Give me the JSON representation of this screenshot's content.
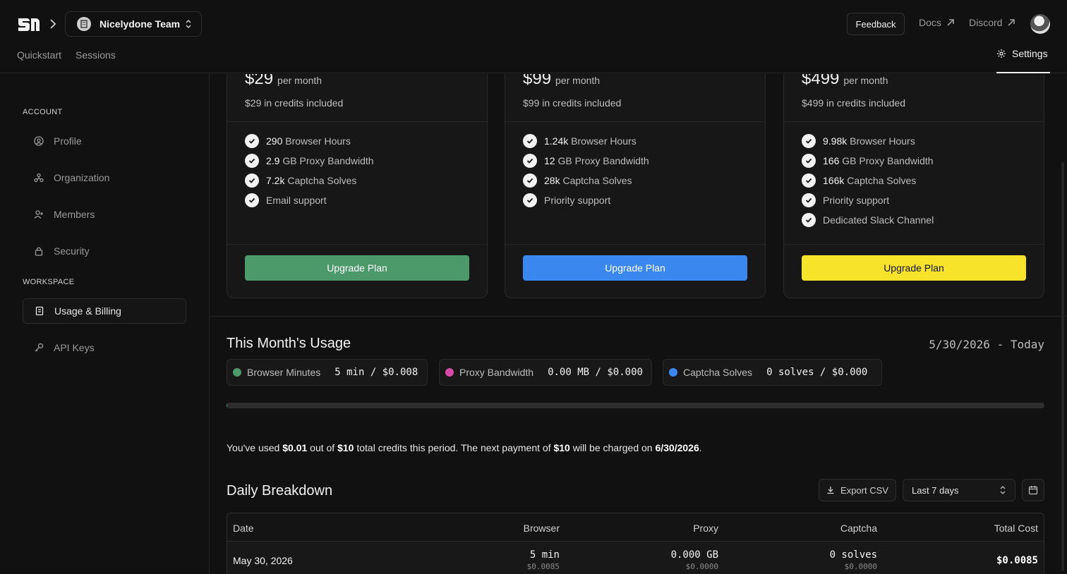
{
  "header": {
    "team_name": "Nicelydone Team",
    "feedback_label": "Feedback",
    "docs_label": "Docs",
    "discord_label": "Discord",
    "tabs": [
      {
        "label": "Quickstart"
      },
      {
        "label": "Sessions"
      }
    ],
    "settings_label": "Settings"
  },
  "sidebar": {
    "account_heading": "ACCOUNT",
    "workspace_heading": "WORKSPACE",
    "items": [
      {
        "label": "Profile",
        "icon": "user-circle-icon"
      },
      {
        "label": "Organization",
        "icon": "organization-icon"
      },
      {
        "label": "Members",
        "icon": "user-plus-icon"
      },
      {
        "label": "Security",
        "icon": "lock-icon"
      },
      {
        "label": "Usage & Billing",
        "icon": "receipt-icon"
      },
      {
        "label": "API Keys",
        "icon": "key-icon"
      }
    ],
    "active": "Usage & Billing"
  },
  "plans": [
    {
      "price": "$29",
      "per": "per month",
      "credits": "$29 in credits included",
      "features": [
        {
          "value": "290",
          "label": "Browser Hours"
        },
        {
          "value": "2.9",
          "label": "GB Proxy Bandwidth"
        },
        {
          "value": "7.2k",
          "label": "Captcha Solves"
        },
        {
          "value": "",
          "label": "Email support"
        }
      ],
      "button": "Upgrade Plan",
      "button_color": "#4c9a6a",
      "button_text_color": "#ffffff"
    },
    {
      "price": "$99",
      "per": "per month",
      "credits": "$99 in credits included",
      "features": [
        {
          "value": "1.24k",
          "label": "Browser Hours"
        },
        {
          "value": "12",
          "label": "GB Proxy Bandwidth"
        },
        {
          "value": "28k",
          "label": "Captcha Solves"
        },
        {
          "value": "",
          "label": "Priority support"
        }
      ],
      "button": "Upgrade Plan",
      "button_color": "#3b87f0",
      "button_text_color": "#ffffff"
    },
    {
      "price": "$499",
      "per": "per month",
      "credits": "$499 in credits included",
      "features": [
        {
          "value": "9.98k",
          "label": "Browser Hours"
        },
        {
          "value": "166",
          "label": "GB Proxy Bandwidth"
        },
        {
          "value": "166k",
          "label": "Captcha Solves"
        },
        {
          "value": "",
          "label": "Priority support"
        },
        {
          "value": "",
          "label": "Dedicated Slack Channel"
        }
      ],
      "button": "Upgrade Plan",
      "button_color": "#f7e32a",
      "button_text_color": "#111111"
    }
  ],
  "usage": {
    "title": "This Month's Usage",
    "range": "5/30/2026 - Today",
    "chips": [
      {
        "label": "Browser Minutes",
        "value": "5 min / $0.008",
        "color": "#4c9a6a"
      },
      {
        "label": "Proxy Bandwidth",
        "value": "0.00 MB / $0.000",
        "color": "#d64aa6"
      },
      {
        "label": "Captcha Solves",
        "value": "0 solves / $0.000",
        "color": "#3b87f0"
      }
    ],
    "progress": 0.001,
    "credit_text": {
      "p1": "You've used ",
      "used": "$0.01",
      "p2": " out of ",
      "total": "$10",
      "p3": " total credits this period. The next payment of ",
      "payment": "$10",
      "p4": " will be charged on ",
      "date": "6/30/2026",
      "p5": "."
    }
  },
  "daily": {
    "title": "Daily Breakdown",
    "export_label": "Export CSV",
    "range_value": "Last 7 days",
    "columns": [
      "Date",
      "Browser",
      "Proxy",
      "Captcha",
      "Total Cost"
    ],
    "rows": [
      {
        "date": "May 30, 2026",
        "browser": "5 min",
        "browser_cost": "$0.0085",
        "proxy": "0.000 GB",
        "proxy_cost": "$0.0000",
        "captcha": "0 solves",
        "captcha_cost": "$0.0000",
        "total": "$0.0085"
      }
    ]
  }
}
